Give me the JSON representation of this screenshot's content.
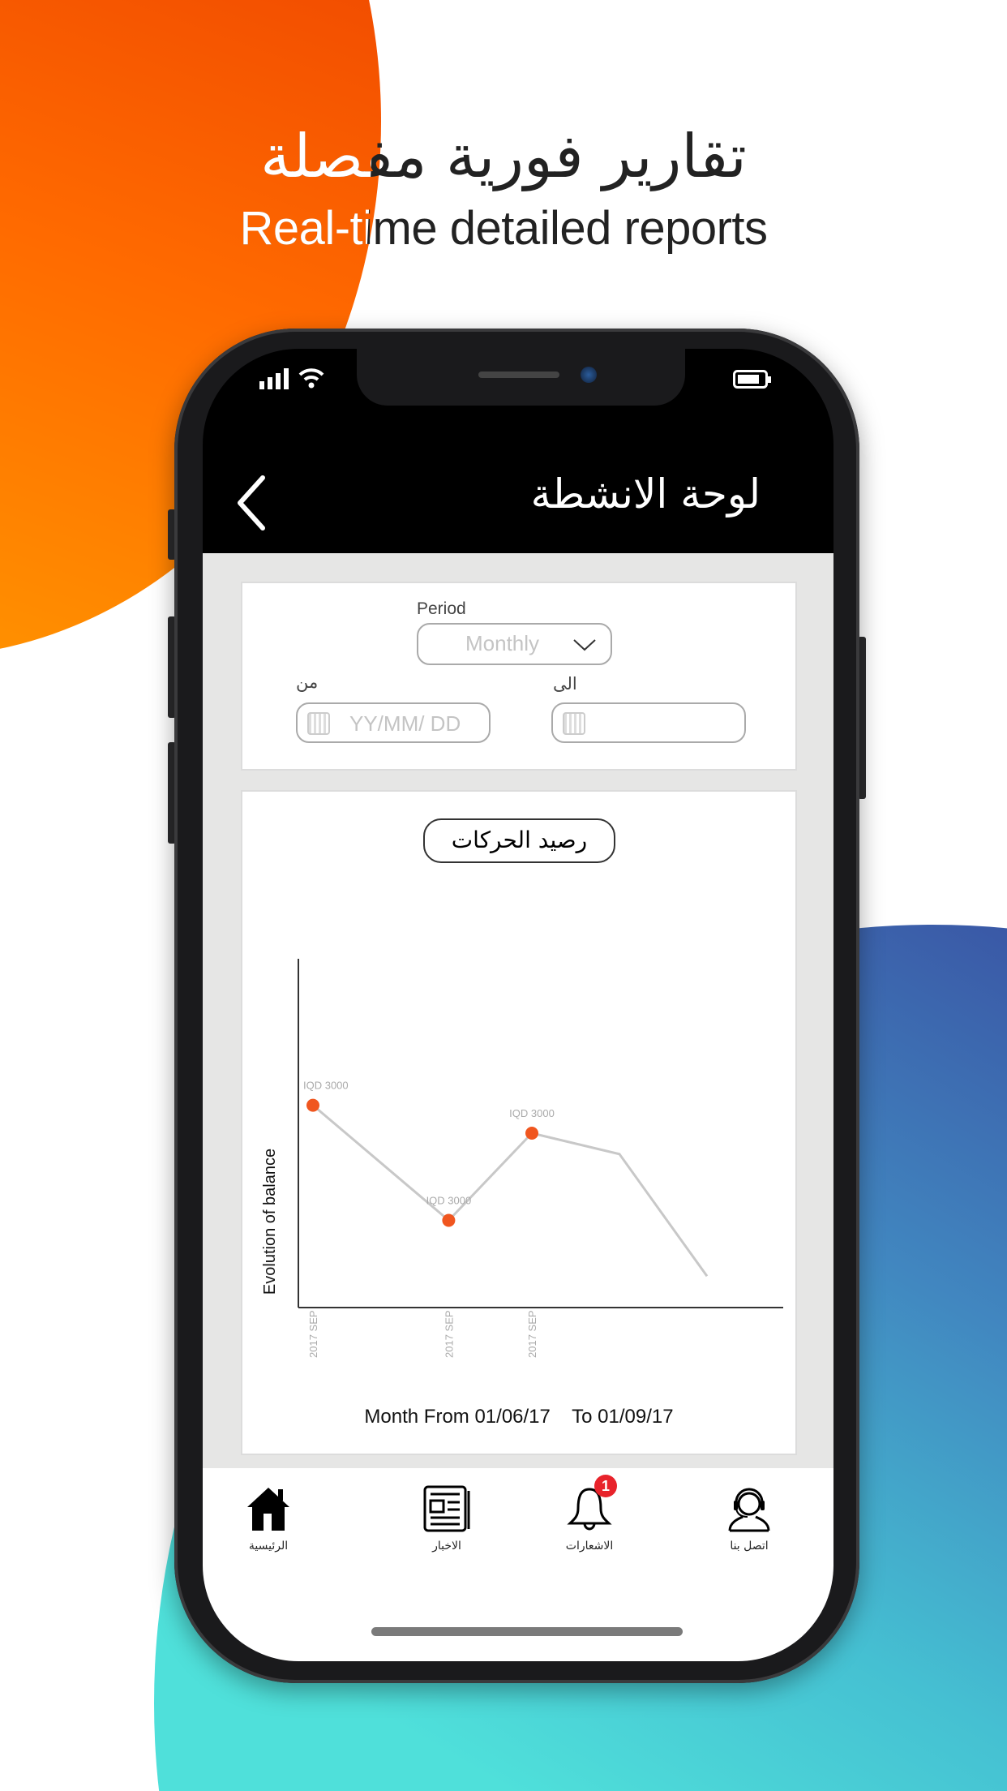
{
  "promo": {
    "title_ar": "تقارير فورية مفصلة",
    "title_en": "Real-time detailed reports",
    "colors": {
      "orange": "#f55a00",
      "blue": "#3a58a6",
      "teal": "#4fe0da"
    }
  },
  "status_bar": {
    "signal_icon": "signal-bars-icon",
    "wifi_icon": "wifi-icon",
    "battery_icon": "battery-icon"
  },
  "header": {
    "title": "لوحة الانشطة",
    "back_icon": "chevron-left-icon"
  },
  "filters": {
    "period_label": "Period",
    "period_value": "Monthly",
    "from_label": "من",
    "from_placeholder": "YY/MM/ DD",
    "to_label": "الى",
    "to_placeholder": ""
  },
  "chart_card": {
    "button_label": "رصيد الحركات",
    "footer": "Month From 01/06/17    To 01/09/17"
  },
  "chart_data": {
    "type": "line",
    "ylabel": "Evolution of balance",
    "x_tick_labels": [
      "2017 SEP",
      "2017 SEP",
      "2017 SEP"
    ],
    "points": [
      {
        "x": 0,
        "y": 0.58,
        "label": "IQD 3000",
        "marker": true,
        "tick": "2017 SEP"
      },
      {
        "x": 0.31,
        "y": 0.25,
        "label": "IQD 3000",
        "marker": true,
        "tick": "2017 SEP"
      },
      {
        "x": 0.5,
        "y": 0.5,
        "label": "IQD 3000",
        "marker": true,
        "tick": "2017 SEP"
      },
      {
        "x": 0.7,
        "y": 0.44,
        "marker": false
      },
      {
        "x": 0.9,
        "y": 0.09,
        "marker": false
      }
    ],
    "line_color": "#c8c8c8",
    "marker_color": "#f0561f",
    "grid": false
  },
  "nav": {
    "items": [
      {
        "label": "الرئيسية",
        "icon": "home-icon"
      },
      {
        "label": "الاخبار",
        "icon": "newspaper-icon"
      },
      {
        "label": "الاشعارات",
        "icon": "bell-icon",
        "badge": "1"
      },
      {
        "label": "اتصل بنا",
        "icon": "headset-icon"
      }
    ]
  }
}
